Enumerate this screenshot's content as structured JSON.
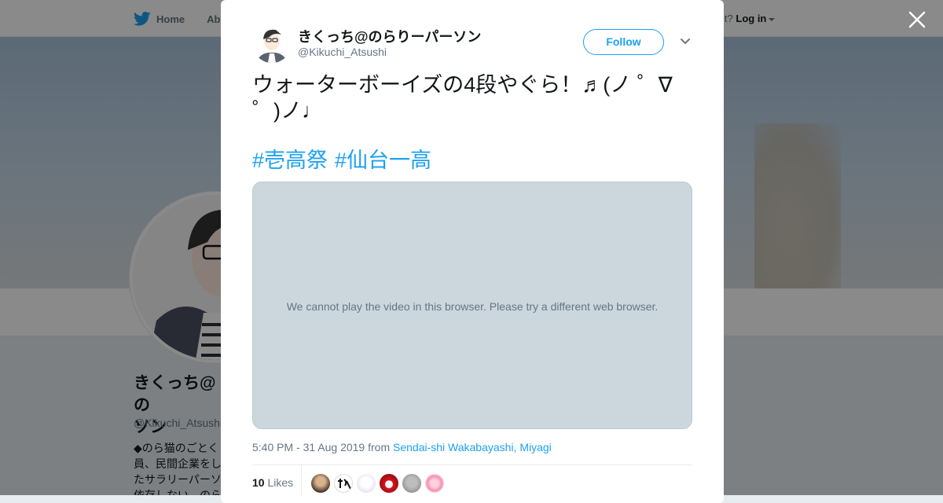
{
  "background_page": {
    "nav": {
      "home_label": "Home",
      "about_label": "Abo"
    },
    "login": {
      "prompt": "account?",
      "login_label": "Log in"
    },
    "profile": {
      "name_line1": "きくっち@の",
      "name_line2": "ソン",
      "handle": "@Kikuchi_Atsushi",
      "bio_lines": [
        "◆のら猫のごとく",
        "員、民間企業をし",
        "たサラリーパーソ",
        "依存しない、のら"
      ]
    }
  },
  "tweet": {
    "author_name": "きくっち@のらりーパーソン",
    "author_handle": "@Kikuchi_Atsushi",
    "follow_label": "Follow",
    "text": "ウォーターボーイズの4段やぐら！♬(ノ ゜∇ ゜)ノ♩",
    "hashtags": [
      "#壱高祭",
      "#仙台一高"
    ],
    "video_message": "We cannot play the video in this browser. Please try a different web browser.",
    "timestamp": "5:40 PM - 31 Aug 2019",
    "from_label": "from",
    "location": "Sendai-shi Wakabayashi, Miyagi",
    "likes_count": "10",
    "likes_label": "Likes",
    "liker_avatar_count": 6
  },
  "colors": {
    "accent": "#1da1f2",
    "overlay": "rgba(0,0,0,0.46)",
    "video_bg": "#ccd6dd"
  },
  "icons": [
    "twitter-bird-icon",
    "close-icon",
    "chevron-down-icon"
  ]
}
